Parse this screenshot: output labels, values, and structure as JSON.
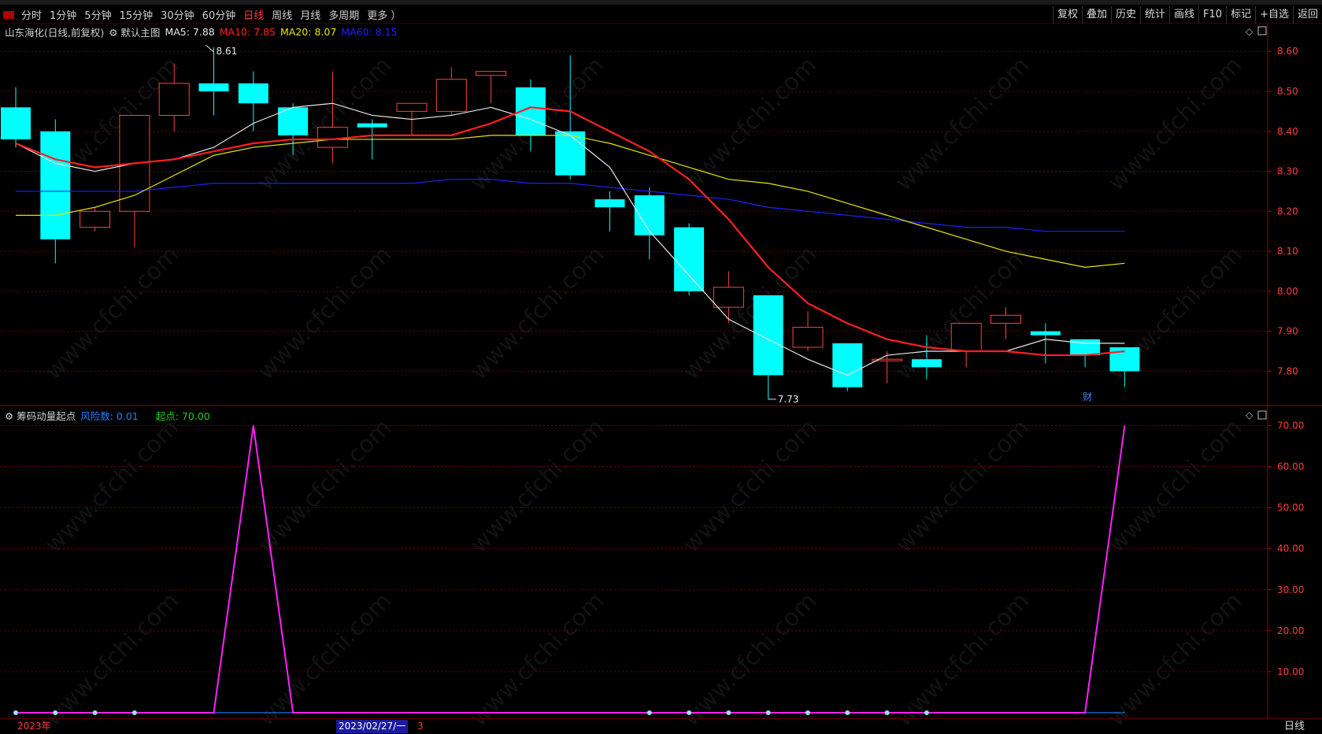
{
  "toolbar": {
    "periods": [
      "分时",
      "1分钟",
      "5分钟",
      "15分钟",
      "30分钟",
      "60分钟",
      "日线",
      "周线",
      "月线",
      "多周期",
      "更多 ）"
    ],
    "active_period": "日线",
    "buttons": [
      "复权",
      "叠加",
      "历史",
      "统计",
      "画线",
      "F10",
      "标记",
      "+自选",
      "返回"
    ]
  },
  "main_legend": {
    "stock": "山东海化(日线,前复权)",
    "template": "默认主图",
    "ma5": "MA5: 7.88",
    "ma10": "MA10: 7.85",
    "ma20": "MA20: 8.07",
    "ma60": "MA60: 8.15"
  },
  "sub_legend": {
    "indicator": "筹码动量起点",
    "risk": "风险数: 0.01",
    "start": "起点: 70.00"
  },
  "annotations": {
    "high": "8.61",
    "low": "7.73",
    "finance": "财"
  },
  "footer": {
    "year": "2023年",
    "cursor_date": "2023/02/27/一",
    "mark": "3",
    "period": "日线"
  },
  "watermark": "www.cfchi.com",
  "colors": {
    "up": "#ff4040",
    "down": "#00ffff",
    "ma5": "#e8e8e8",
    "ma10": "#ff2020",
    "ma20": "#e6e600",
    "ma60": "#2020ff",
    "signal": "#ff20ff",
    "risk": "#2080ff"
  },
  "chart_data": [
    {
      "type": "candlestick",
      "title": "山东海化(日线,前复权)",
      "y_axis_ticks": [
        8.6,
        8.5,
        8.4,
        8.3,
        8.2,
        8.1,
        8.0,
        7.9,
        7.8
      ],
      "ylim": [
        7.72,
        8.63
      ],
      "candles": [
        {
          "o": 8.46,
          "h": 8.51,
          "l": 8.36,
          "c": 8.38
        },
        {
          "o": 8.4,
          "h": 8.43,
          "l": 8.07,
          "c": 8.13
        },
        {
          "o": 8.16,
          "h": 8.21,
          "l": 8.15,
          "c": 8.2
        },
        {
          "o": 8.2,
          "h": 8.44,
          "l": 8.11,
          "c": 8.44
        },
        {
          "o": 8.44,
          "h": 8.57,
          "l": 8.4,
          "c": 8.52
        },
        {
          "o": 8.52,
          "h": 8.61,
          "l": 8.44,
          "c": 8.5
        },
        {
          "o": 8.52,
          "h": 8.55,
          "l": 8.4,
          "c": 8.47
        },
        {
          "o": 8.46,
          "h": 8.47,
          "l": 8.34,
          "c": 8.39
        },
        {
          "o": 8.36,
          "h": 8.55,
          "l": 8.32,
          "c": 8.41
        },
        {
          "o": 8.42,
          "h": 8.43,
          "l": 8.33,
          "c": 8.41
        },
        {
          "o": 8.45,
          "h": 8.47,
          "l": 8.39,
          "c": 8.47
        },
        {
          "o": 8.45,
          "h": 8.56,
          "l": 8.44,
          "c": 8.53
        },
        {
          "o": 8.54,
          "h": 8.55,
          "l": 8.47,
          "c": 8.55
        },
        {
          "o": 8.51,
          "h": 8.53,
          "l": 8.35,
          "c": 8.39
        },
        {
          "o": 8.4,
          "h": 8.59,
          "l": 8.28,
          "c": 8.29
        },
        {
          "o": 8.23,
          "h": 8.25,
          "l": 8.15,
          "c": 8.21
        },
        {
          "o": 8.24,
          "h": 8.26,
          "l": 8.08,
          "c": 8.14
        },
        {
          "o": 8.16,
          "h": 8.17,
          "l": 7.99,
          "c": 8.0
        },
        {
          "o": 7.96,
          "h": 8.05,
          "l": 7.92,
          "c": 8.01
        },
        {
          "o": 7.99,
          "h": 7.99,
          "l": 7.73,
          "c": 7.79
        },
        {
          "o": 7.86,
          "h": 7.95,
          "l": 7.85,
          "c": 7.91
        },
        {
          "o": 7.87,
          "h": 7.87,
          "l": 7.75,
          "c": 7.76
        },
        {
          "o": 7.83,
          "h": 7.85,
          "l": 7.77,
          "c": 7.83
        },
        {
          "o": 7.83,
          "h": 7.89,
          "l": 7.78,
          "c": 7.81
        },
        {
          "o": 7.85,
          "h": 7.92,
          "l": 7.81,
          "c": 7.92
        },
        {
          "o": 7.92,
          "h": 7.96,
          "l": 7.88,
          "c": 7.94
        },
        {
          "o": 7.9,
          "h": 7.92,
          "l": 7.82,
          "c": 7.89
        },
        {
          "o": 7.88,
          "h": 7.88,
          "l": 7.81,
          "c": 7.84
        },
        {
          "o": 7.86,
          "h": 7.86,
          "l": 7.76,
          "c": 7.8
        }
      ],
      "ma5": [
        8.37,
        8.32,
        8.3,
        8.32,
        8.33,
        8.36,
        8.42,
        8.46,
        8.47,
        8.44,
        8.43,
        8.44,
        8.46,
        8.43,
        8.39,
        8.31,
        8.15,
        8.04,
        7.93,
        7.88,
        7.83,
        7.79,
        7.84,
        7.85,
        7.85,
        7.85,
        7.88,
        7.87,
        7.87
      ],
      "ma10": [
        8.37,
        8.33,
        8.31,
        8.32,
        8.33,
        8.35,
        8.37,
        8.38,
        8.38,
        8.39,
        8.39,
        8.39,
        8.42,
        8.46,
        8.45,
        8.4,
        8.35,
        8.28,
        8.18,
        8.06,
        7.97,
        7.92,
        7.88,
        7.86,
        7.85,
        7.85,
        7.84,
        7.84,
        7.85
      ],
      "ma20": [
        8.19,
        8.19,
        8.21,
        8.24,
        8.29,
        8.34,
        8.36,
        8.37,
        8.38,
        8.38,
        8.38,
        8.38,
        8.39,
        8.39,
        8.39,
        8.37,
        8.34,
        8.31,
        8.28,
        8.27,
        8.25,
        8.22,
        8.19,
        8.16,
        8.13,
        8.1,
        8.08,
        8.06,
        8.07
      ],
      "ma60": [
        8.25,
        8.25,
        8.25,
        8.25,
        8.26,
        8.27,
        8.27,
        8.27,
        8.27,
        8.27,
        8.27,
        8.28,
        8.28,
        8.27,
        8.27,
        8.26,
        8.25,
        8.24,
        8.23,
        8.21,
        8.2,
        8.19,
        8.18,
        8.17,
        8.16,
        8.16,
        8.15,
        8.15,
        8.15
      ]
    },
    {
      "type": "line",
      "title": "筹码动量起点",
      "y_axis_ticks": [
        70,
        60,
        50,
        40,
        30,
        20,
        10
      ],
      "ylim": [
        0,
        72
      ],
      "series": [
        {
          "name": "起点",
          "values": [
            0,
            0,
            0,
            0,
            0,
            0,
            70,
            0,
            0,
            0,
            0,
            0,
            0,
            0,
            0,
            0,
            0,
            0,
            0,
            0,
            0,
            0,
            0,
            0,
            0,
            0,
            0,
            0,
            70
          ]
        },
        {
          "name": "风险数",
          "values": [
            0.01,
            0.01,
            0.01,
            0.01,
            0.01,
            0.01,
            0.01,
            0.01,
            0.01,
            0.01,
            0.01,
            0.01,
            0.01,
            0.01,
            0.01,
            0.01,
            0.01,
            0.01,
            0.01,
            0.01,
            0.01,
            0.01,
            0.01,
            0.01,
            0.01,
            0.01,
            0.01,
            0.01,
            0.01
          ]
        }
      ],
      "dot_markers_at": [
        0,
        1,
        2,
        3,
        16,
        17,
        18,
        19,
        20,
        21,
        22,
        23
      ]
    }
  ]
}
